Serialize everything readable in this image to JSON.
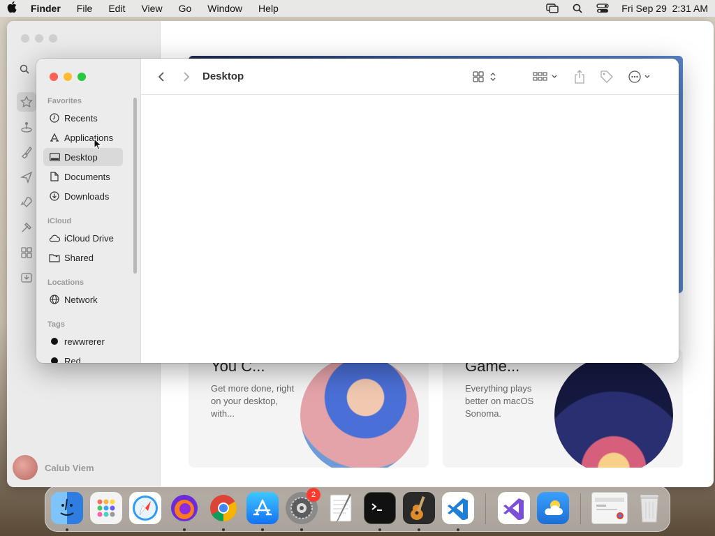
{
  "menubar": {
    "app_name": "Finder",
    "menus": [
      "File",
      "Edit",
      "View",
      "Go",
      "Window",
      "Help"
    ],
    "clock": "Fri Sep 29  2:31 AM"
  },
  "background_window": {
    "user_name": "Calub Viem",
    "card1": {
      "title": "You C...",
      "desc": "Get more done, right on your desktop, with..."
    },
    "card2": {
      "title": "Game...",
      "desc": "Everything plays better on macOS Sonoma."
    }
  },
  "finder": {
    "title": "Desktop",
    "sections": {
      "favorites": "Favorites",
      "icloud": "iCloud",
      "locations": "Locations",
      "tags": "Tags"
    },
    "favorites": [
      {
        "label": "Recents",
        "icon": "clock-icon"
      },
      {
        "label": "Applications",
        "icon": "applications-icon"
      },
      {
        "label": "Desktop",
        "icon": "desktop-icon"
      },
      {
        "label": "Documents",
        "icon": "document-icon"
      },
      {
        "label": "Downloads",
        "icon": "download-icon"
      }
    ],
    "icloud": [
      {
        "label": "iCloud Drive",
        "icon": "cloud-icon"
      },
      {
        "label": "Shared",
        "icon": "shared-folder-icon"
      }
    ],
    "locations": [
      {
        "label": "Network",
        "icon": "globe-icon"
      }
    ],
    "tags": [
      {
        "label": "rewwrerer",
        "color": "#111111"
      },
      {
        "label": "Red",
        "color": "#111111"
      }
    ],
    "selected": "Desktop"
  },
  "dock": {
    "apps": [
      {
        "name": "Finder",
        "running": true
      },
      {
        "name": "Launchpad",
        "running": false
      },
      {
        "name": "Safari",
        "running": false
      },
      {
        "name": "Firefox",
        "running": true
      },
      {
        "name": "Chrome",
        "running": true
      },
      {
        "name": "App Store",
        "running": true
      },
      {
        "name": "System Settings",
        "running": true,
        "badge": "2"
      },
      {
        "name": "TextEdit",
        "running": false
      },
      {
        "name": "Terminal",
        "running": true
      },
      {
        "name": "GarageBand",
        "running": true
      },
      {
        "name": "Visual Studio Code",
        "running": true
      },
      {
        "name": "Visual Studio",
        "running": false
      },
      {
        "name": "Weather",
        "running": false
      },
      {
        "name": "Chrome Window",
        "running": false
      },
      {
        "name": "Trash",
        "running": false
      }
    ]
  }
}
